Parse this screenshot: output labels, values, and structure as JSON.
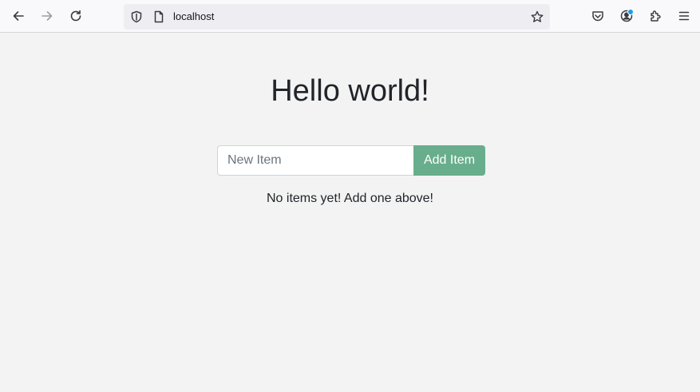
{
  "browser": {
    "url": "localhost",
    "icons": {
      "back": "arrow-left-icon",
      "forward": "arrow-right-icon",
      "reload": "reload-icon",
      "tracking": "shield-icon",
      "page": "page-icon",
      "bookmark": "star-icon",
      "pocket": "pocket-icon",
      "account": "account-icon",
      "extensions": "puzzle-icon",
      "menu": "hamburger-icon"
    }
  },
  "page": {
    "title": "Hello world!",
    "new_item_placeholder": "New Item",
    "add_button_label": "Add Item",
    "empty_message": "No items yet! Add one above!",
    "accent_color": "#68ae8c"
  }
}
